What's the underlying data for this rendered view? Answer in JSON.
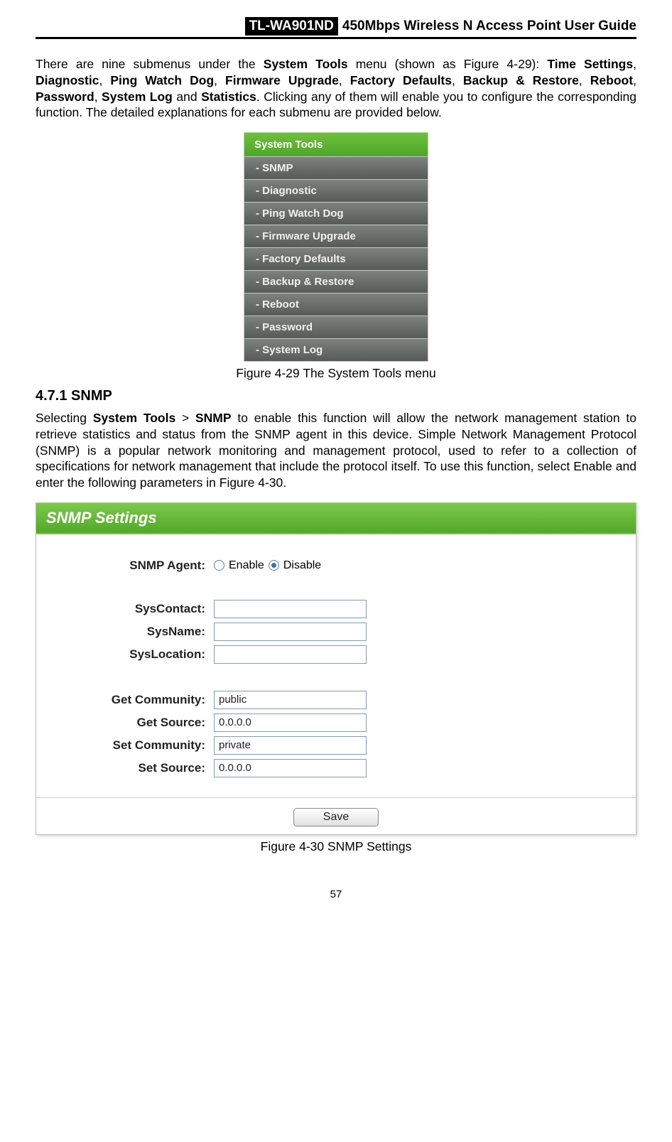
{
  "header": {
    "model": "TL-WA901ND",
    "title": "450Mbps Wireless N Access Point User Guide"
  },
  "intro": {
    "pre": "There are nine submenus under the ",
    "m1": "System Tools",
    "mid": " menu (shown as Figure 4-29): ",
    "b1": "Time Settings",
    "c1": ", ",
    "b2": "Diagnostic",
    "c2": ", ",
    "b3": "Ping Watch Dog",
    "c3": ", ",
    "b4": "Firmware Upgrade",
    "c4": ", ",
    "b5": "Factory Defaults",
    "c5": ", ",
    "b6": "Backup & Restore",
    "c6": ", ",
    "b7": "Reboot",
    "c7": ", ",
    "b8": "Password",
    "c8": ", ",
    "b9": "System Log",
    "and": " and ",
    "b10": "Statistics",
    "tail": ". Clicking any of them will enable you to configure the corresponding function. The detailed explanations for each submenu are provided below."
  },
  "menu": {
    "header": "System Tools",
    "items": [
      "- SNMP",
      "- Diagnostic",
      "- Ping Watch Dog",
      "- Firmware Upgrade",
      "- Factory Defaults",
      "- Backup & Restore",
      "- Reboot",
      "- Password",
      "- System Log"
    ]
  },
  "caption1": "Figure 4-29 The System Tools menu",
  "section": "4.7.1  SNMP",
  "snmp_paragraph": {
    "pre": "Selecting ",
    "b1": "System Tools",
    "gt": " > ",
    "b2": "SNMP",
    "tail": " to enable this function will allow the network management station to retrieve statistics and status from the SNMP agent in this device. Simple Network Management Protocol (SNMP) is a popular network monitoring and management protocol, used to refer to a collection of specifications for network management that include the protocol itself. To use this function, select Enable and enter the following parameters in Figure 4-30."
  },
  "snmp": {
    "panel_title": "SNMP Settings",
    "agent_label": "SNMP Agent:",
    "enable": "Enable",
    "disable": "Disable",
    "agent_selected": "disable",
    "syscontact_label": "SysContact:",
    "syscontact_value": "",
    "sysname_label": "SysName:",
    "sysname_value": "",
    "syslocation_label": "SysLocation:",
    "syslocation_value": "",
    "getcommunity_label": "Get Community:",
    "getcommunity_value": "public",
    "getsource_label": "Get Source:",
    "getsource_value": "0.0.0.0",
    "setcommunity_label": "Set Community:",
    "setcommunity_value": "private",
    "setsource_label": "Set Source:",
    "setsource_value": "0.0.0.0",
    "save": "Save"
  },
  "caption2": "Figure 4-30 SNMP Settings",
  "page_number": "57"
}
